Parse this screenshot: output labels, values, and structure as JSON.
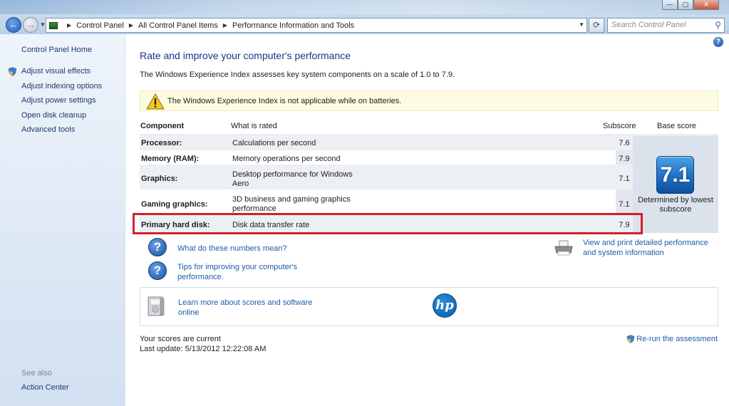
{
  "window": {
    "min_glyph": "—",
    "max_glyph": "▢",
    "close_glyph": "✕"
  },
  "navigation": {
    "back_glyph": "←",
    "forward_glyph": "→",
    "breadcrumbs": [
      "Control Panel",
      "All Control Panel Items",
      "Performance Information and Tools"
    ],
    "search_placeholder": "Search Control Panel"
  },
  "sidebar": {
    "home": "Control Panel Home",
    "items": [
      {
        "label": "Adjust visual effects",
        "icon": "uac-shield-icon"
      },
      {
        "label": "Adjust indexing options"
      },
      {
        "label": "Adjust power settings"
      },
      {
        "label": "Open disk cleanup"
      },
      {
        "label": "Advanced tools"
      }
    ],
    "see_also": "See also",
    "see_also_items": [
      "Action Center"
    ]
  },
  "main": {
    "title": "Rate and improve your computer's performance",
    "description": "The Windows Experience Index assesses key system components on a scale of 1.0 to 7.9.",
    "warning": "The Windows Experience Index is not applicable while on batteries.",
    "table": {
      "headers": {
        "component": "Component",
        "what": "What is rated",
        "subscore": "Subscore",
        "base": "Base score"
      },
      "rows": [
        {
          "component": "Processor:",
          "what": "Calculations per second",
          "subscore": "7.6"
        },
        {
          "component": "Memory (RAM):",
          "what": "Memory operations per second",
          "subscore": "7.9"
        },
        {
          "component": "Graphics:",
          "what": "Desktop performance for Windows Aero",
          "subscore": "7.1"
        },
        {
          "component": "Gaming graphics:",
          "what": "3D business and gaming graphics performance",
          "subscore": "7.1"
        },
        {
          "component": "Primary hard disk:",
          "what": "Disk data transfer rate",
          "subscore": "7.9"
        }
      ],
      "base_score": "7.1",
      "base_caption": "Determined by lowest subscore"
    },
    "links": {
      "numbers": "What do these numbers mean?",
      "tips": "Tips for improving your computer's performance.",
      "print": "View and print detailed performance and system information",
      "learn": "Learn more about scores and software online"
    },
    "oem_logo_text": "hp",
    "status": "Your scores are current",
    "last_update": "Last update: 5/13/2012 12:22:08 AM",
    "rerun": "Re-run the assessment"
  },
  "colors": {
    "highlight_border": "#d0202c",
    "link": "#1c5ca8",
    "title": "#1e3287"
  }
}
